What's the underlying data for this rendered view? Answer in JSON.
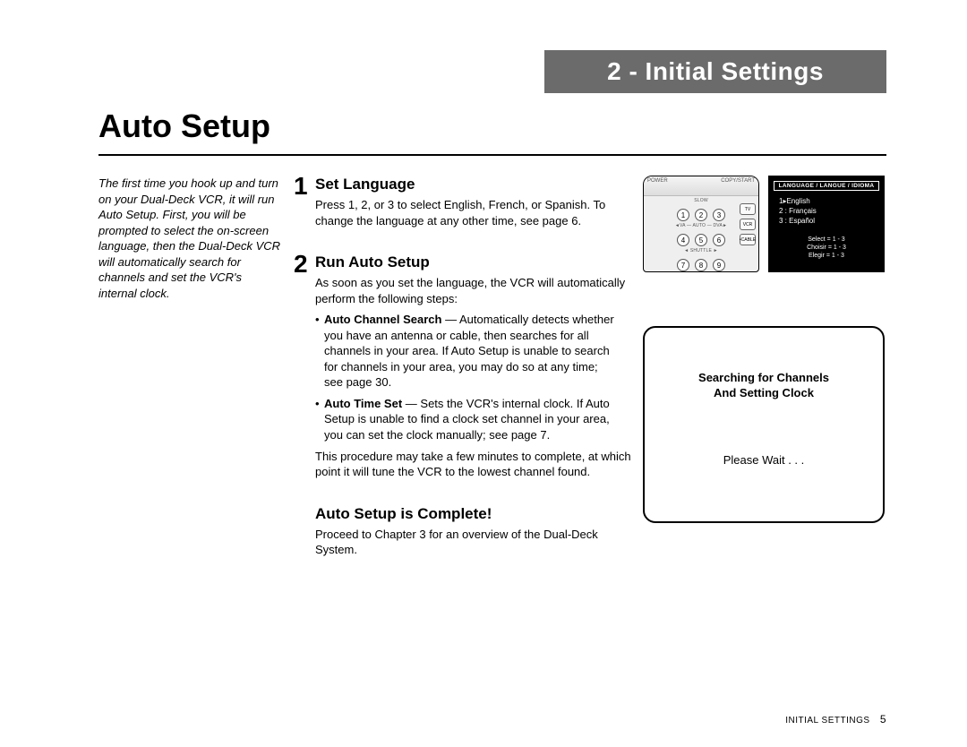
{
  "chapter_bar": "2 - Initial Settings",
  "page_title": "Auto Setup",
  "intro": "The first time you hook up and turn on your Dual-Deck VCR, it will run Auto Setup. First, you will be prompted to select the on-screen language, then the Dual-Deck VCR will automatically search for channels and set the VCR's internal clock.",
  "step1": {
    "num": "1",
    "heading": "Set Language",
    "body": "Press 1, 2, or 3 to select English, French, or Spanish. To change the language at any other time, see page 6."
  },
  "step2": {
    "num": "2",
    "heading": "Run Auto Setup",
    "body_top": "As soon as you set the language, the VCR will automatically perform the following steps:",
    "bullet_a_bold": "Auto Channel Search",
    "bullet_a_rest": " — Automatically detects whether you have an antenna or cable, then searches for all channels in your area. If Auto Setup is unable to search for channels in your area, you may do so at any time; see page 30.",
    "bullet_b_bold": "Auto Time Set",
    "bullet_b_rest": " — Sets the VCR's internal clock. If Auto Setup is unable to find a clock set channel in your area, you can set the clock manually; see page 7.",
    "body_bottom": "This procedure may take a few minutes to complete, at which point it will tune the VCR to the lowest channel found."
  },
  "complete": {
    "heading": "Auto Setup is Complete!",
    "body": "Proceed to Chapter 3 for an overview of the Dual-Deck System."
  },
  "remote": {
    "power": "POWER",
    "copy": "COPY/START",
    "slow": "SLOW",
    "btn1": "1",
    "btn2": "2",
    "btn3": "3",
    "btn4": "4",
    "btn5": "5",
    "btn6": "6",
    "btn7": "7",
    "btn8": "8",
    "btn9": "9",
    "midlabel": "◄VA — AUTO — DVA►",
    "shuttle": "◄ SHUTTLE ►",
    "side_tv": "TV",
    "side_vcr": "VCR",
    "side_cable": "•CABLE"
  },
  "lang_osd": {
    "header": "LANGUAGE / LANGUE / IDIOMA",
    "opt1": "1▸English",
    "opt2": "2 : Français",
    "opt3": "3 : Español",
    "sel1": "Select = 1 - 3",
    "sel2": "Choisir = 1 - 3",
    "sel3": "Elegir = 1 - 3"
  },
  "search_box": {
    "line1": "Searching for Channels",
    "line2": "And Setting Clock",
    "wait": "Please Wait . . ."
  },
  "footer": {
    "label": "INITIAL SETTINGS",
    "page": "5"
  }
}
